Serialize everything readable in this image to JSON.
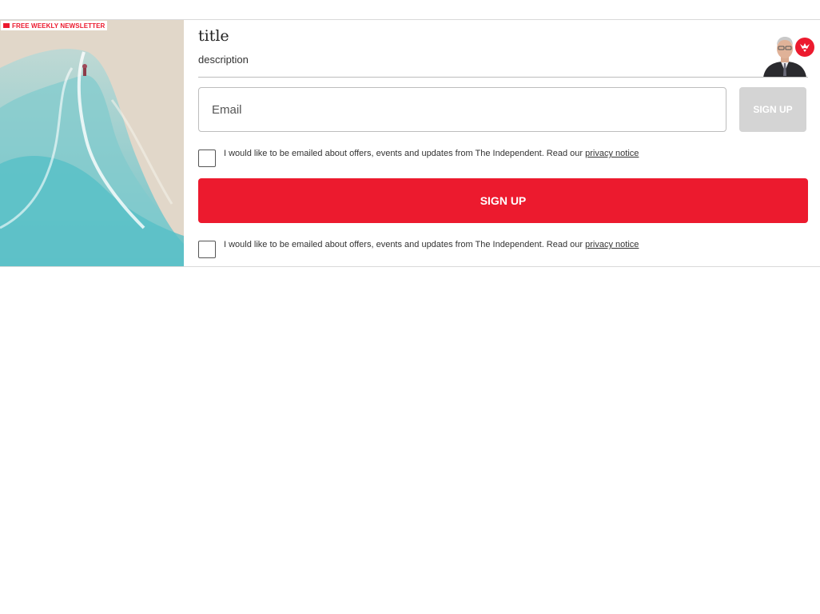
{
  "badge": {
    "label": "FREE WEEKLY NEWSLETTER"
  },
  "newsletter": {
    "title": "title",
    "description": "description"
  },
  "email": {
    "placeholder": "Email"
  },
  "buttons": {
    "small_signup": "SIGN UP",
    "main_signup": "SIGN UP"
  },
  "consent": [
    {
      "text": "I would like to be emailed about offers, events and updates from The Independent. Read our ",
      "link": "privacy notice"
    },
    {
      "text": "I would like to be emailed about offers, events and updates from The Independent. Read our ",
      "link": "privacy notice"
    }
  ],
  "colors": {
    "brand_red": "#ec1a2e",
    "disabled_button": "#d4d4d4",
    "border": "#bdbdbd"
  },
  "icons": [
    "mail-icon",
    "independent-eagle-logo-icon",
    "author-avatar"
  ]
}
